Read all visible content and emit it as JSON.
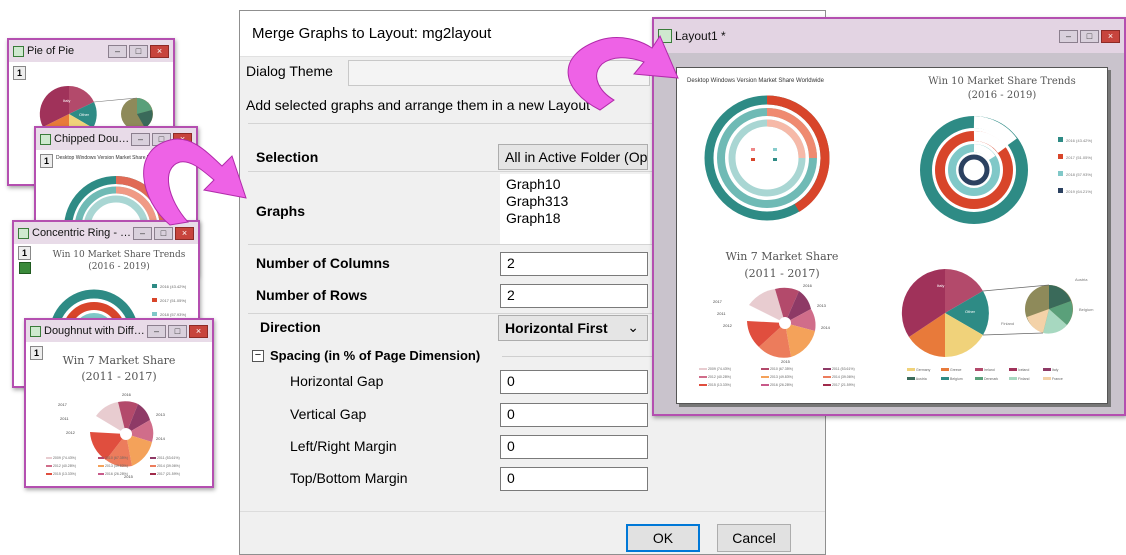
{
  "windows": {
    "pie_of_pie": {
      "title": "Pie of Pie",
      "index": "1",
      "slice_labels": [
        "Italy",
        "Other"
      ]
    },
    "chipped": {
      "title": "Chipped Doug...",
      "index": "1",
      "chart_title": "Desktop Windows Version Market Share Worldwide"
    },
    "concentric": {
      "title": "Concentric Ring - 2...",
      "index": "1",
      "chart_title": "Win 10 Market Share Trends",
      "chart_subtitle": "(2016 - 2019)",
      "legend": [
        "2016 (43.42%)",
        "2017 (51.05%)",
        "2018 (57.93%)"
      ]
    },
    "doughnut": {
      "title": "Doughnut with Differe...",
      "index": "1",
      "chart_title": "Win 7 Market Share",
      "chart_subtitle": "(2011 - 2017)",
      "labels": [
        "2016",
        "2013",
        "2014",
        "2017",
        "2011",
        "2012",
        "2015"
      ],
      "legend": [
        "2009 (74.43%)",
        "2010 (67.35%)",
        "2011 (53.61%)",
        "2012 (40.28%)",
        "2013 (49.83%)",
        "2014 (39.06%)",
        "2015 (13.33%)",
        "2016 (26.28%)",
        "2017 (21.59%)"
      ]
    }
  },
  "dialog": {
    "title": "Merge Graphs to Layout: mg2layout",
    "theme_label": "Dialog Theme",
    "description": "Add selected graphs and arrange them in a new Layout",
    "selection_label": "Selection",
    "selection_value": "All in Active Folder (Op",
    "graphs_label": "Graphs",
    "graphs": [
      "Graph10",
      "Graph313",
      "Graph18"
    ],
    "columns_label": "Number of Columns",
    "columns_value": "2",
    "rows_label": "Number of Rows",
    "rows_value": "2",
    "direction_label": "Direction",
    "direction_value": "Horizontal First",
    "spacing_label": "Spacing (in % of Page Dimension)",
    "hgap_label": "Horizontal Gap",
    "hgap_value": "0",
    "vgap_label": "Vertical Gap",
    "vgap_value": "0",
    "lr_label": "Left/Right Margin",
    "lr_value": "0",
    "tb_label": "Top/Bottom Margin",
    "tb_value": "0",
    "ok_label": "OK",
    "cancel_label": "Cancel"
  },
  "layout": {
    "title": "Layout1 *",
    "g1_title": "Desktop Windows Version Market Share Worldwide",
    "g2_title": "Win 10 Market Share Trends",
    "g2_subtitle": "(2016 - 2019)",
    "g2_legend": [
      "2016 (43.42%)",
      "2017 (51.05%)",
      "2018 (57.93%)",
      "2019 (64.21%)"
    ],
    "g3_title": "Win 7 Market Share",
    "g3_subtitle": "(2011 - 2017)",
    "g3_labels": [
      "2016",
      "2013",
      "2014",
      "2017",
      "2011",
      "2012",
      "2015"
    ],
    "g3_legend": [
      "2009 (74.43%)",
      "2010 (67.35%)",
      "2011 (53.61%)",
      "2012 (40.28%)",
      "2013 (49.83%)",
      "2014 (39.06%)",
      "2015 (13.33%)",
      "2016 (26.28%)",
      "2017 (21.59%)"
    ],
    "g4_slices": [
      "Italy",
      "Other",
      "Austria",
      "Belgium",
      "Finland"
    ],
    "g4_legend": [
      "Germany",
      "Greece",
      "Ireland",
      "Iceland",
      "Italy",
      "Austria",
      "Belgium",
      "Denmark",
      "Finland",
      "France"
    ]
  },
  "colors": {
    "window_border": "#b44fb0",
    "arrow": "#e84fe0",
    "teal": "#2e8b85",
    "red": "#d8452a",
    "light_teal": "#80c8c8",
    "navy": "#2b4160"
  }
}
